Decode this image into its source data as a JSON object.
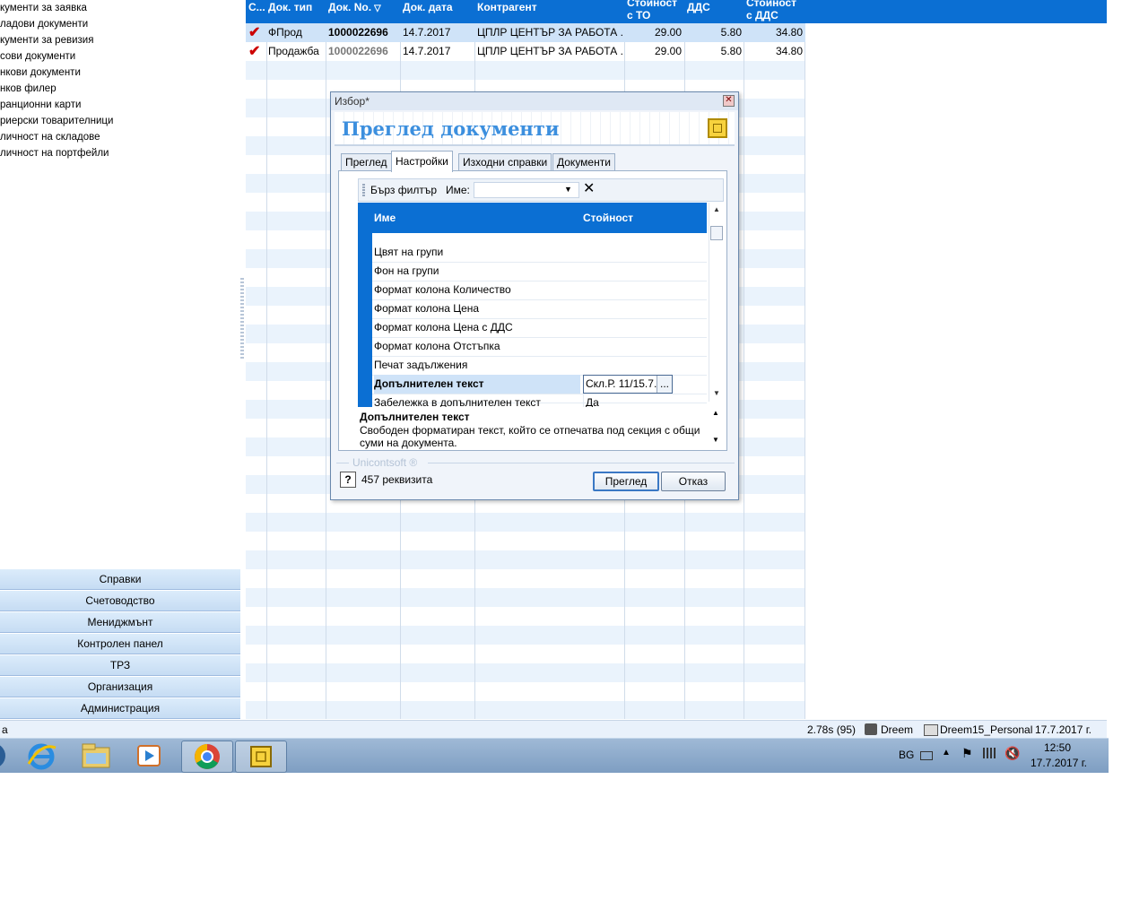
{
  "sidebar": {
    "items": [
      "кументи за заявка",
      "ладови документи",
      "кументи за ревизия",
      "сови документи",
      "нкови документи",
      "нков филер",
      "ранционни карти",
      "риерски товарителници",
      "личност на складове",
      "личност на портфейли"
    ],
    "nav": [
      "Справки",
      "Счетоводство",
      "Мениджмънт",
      "Контролен панел",
      "ТРЗ",
      "Организация",
      "Администрация"
    ]
  },
  "grid": {
    "headers": {
      "status": "С...",
      "doc_type": "Док. тип",
      "doc_no": "Док. No.",
      "sort_indicator": "▽",
      "doc_date": "Док. дата",
      "counterparty": "Контрагент",
      "value_to": "Стойност с ТО",
      "vat": "ДДС",
      "value_vat": "Стойност с ДДС"
    },
    "rows": [
      {
        "check": "✔",
        "type": "ФПрод",
        "no": "1000022696",
        "date": "14.7.2017",
        "counterparty": "ЦПЛР ЦЕНТЪР ЗА РАБОТА ...",
        "value_to": "29.00",
        "vat": "5.80",
        "value_vat": "34.80"
      },
      {
        "check": "✔",
        "type": "Продажба",
        "no": "1000022696",
        "date": "14.7.2017",
        "counterparty": "ЦПЛР ЦЕНТЪР ЗА РАБОТА ...",
        "value_to": "29.00",
        "vat": "5.80",
        "value_vat": "34.80"
      }
    ]
  },
  "dialog": {
    "title": "Избор*",
    "heading": "Преглед документи",
    "tabs": [
      "Преглед",
      "Настройки",
      "Изходни справки",
      "Документи"
    ],
    "active_tab": "Настройки",
    "filter": {
      "quick_label": "Бърз филтър",
      "name_label": "Име:",
      "name_value": ""
    },
    "columns": {
      "name": "Име",
      "value": "Стойност"
    },
    "properties": [
      {
        "name": "Цвят на групи",
        "value": ""
      },
      {
        "name": "Фон на групи",
        "value": ""
      },
      {
        "name": "Формат колона Количество",
        "value": ""
      },
      {
        "name": "Формат колона Цена",
        "value": ""
      },
      {
        "name": "Формат колона Цена с ДДС",
        "value": ""
      },
      {
        "name": "Формат колона Отстъпка",
        "value": ""
      },
      {
        "name": "Печат задължения",
        "value": ""
      },
      {
        "name": "Допълнителен текст",
        "value": "Скл.Р. 11/15.7."
      },
      {
        "name": "Забележка в допълнителен текст",
        "value": "Да"
      }
    ],
    "selected_property": "Допълнителен текст",
    "ellipsis_button": "...",
    "description": {
      "title": "Допълнителен текст",
      "text": "Свободен форматиран текст, който се отпечатва под секция с общи суми на документа."
    },
    "brand": "Unicontsoft ®",
    "field_count": "457 реквизита",
    "buttons": {
      "preview": "Преглед",
      "cancel": "Отказ"
    }
  },
  "statusbar": {
    "left": "а",
    "timing": "2.78s (95)",
    "user": "Dreem",
    "database": "Dreem15_Personal",
    "date": "17.7.2017 г."
  },
  "taskbar": {
    "apps": [
      "internet-explorer",
      "file-explorer",
      "media-player",
      "chrome",
      "unicontsoft"
    ],
    "tray": {
      "language": "BG",
      "time": "12:50",
      "date": "17.7.2017 г."
    }
  },
  "colors": {
    "accent": "#0b6fd3",
    "heading": "#3c8fde",
    "selection": "#cfe3f8"
  }
}
